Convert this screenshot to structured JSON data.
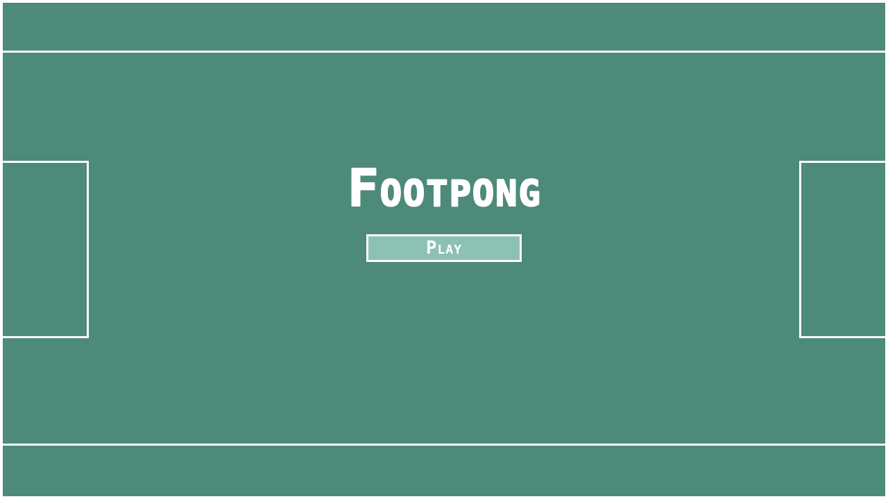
{
  "game": {
    "title": "Footpong",
    "play_label": "Play"
  },
  "colors": {
    "pitch": "#4d8a79",
    "lines": "#ffffff",
    "button_fill": "#8cc1b3",
    "text": "#ffffff",
    "frame": "#ffffff"
  }
}
